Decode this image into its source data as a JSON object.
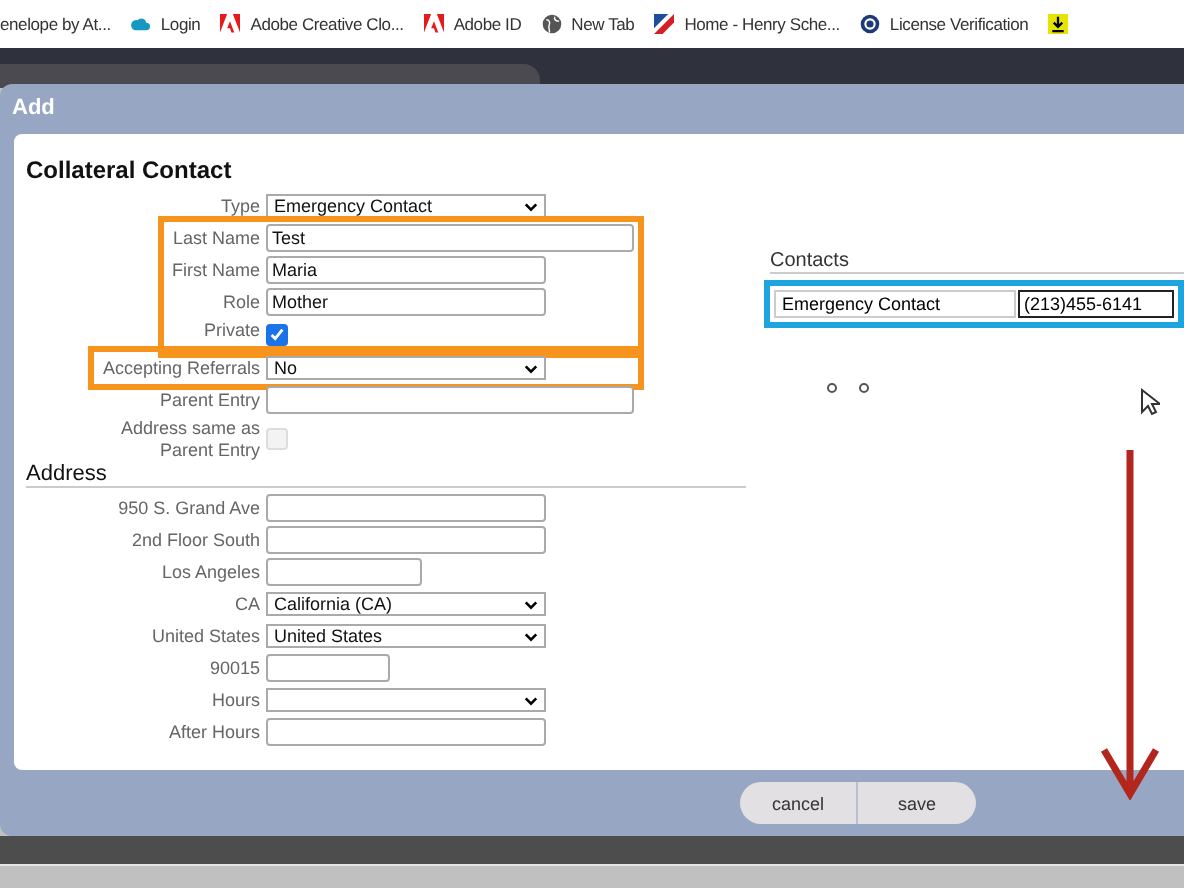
{
  "bookmarks": [
    {
      "label": "enelope by At...",
      "kind": "none"
    },
    {
      "label": "Login",
      "kind": "cloud"
    },
    {
      "label": "Adobe Creative Clo...",
      "kind": "adobe"
    },
    {
      "label": "Adobe ID",
      "kind": "adobe"
    },
    {
      "label": "New Tab",
      "kind": "globe"
    },
    {
      "label": "Home - Henry Sche...",
      "kind": "flag"
    },
    {
      "label": "License Verification",
      "kind": "seal"
    },
    {
      "kind": "download"
    }
  ],
  "dialog": {
    "title": "Add",
    "heading": "Collateral Contact",
    "sections": [
      {
        "highlighted": false,
        "rows": [
          {
            "kind": "select",
            "label": "Type",
            "value": "Emergency Contact"
          }
        ]
      },
      {
        "highlighted": true,
        "rows": [
          {
            "kind": "text",
            "label": "Last Name",
            "value": "Test",
            "wide": true
          },
          {
            "kind": "text",
            "label": "First Name",
            "value": "Maria"
          },
          {
            "kind": "text",
            "label": "Role",
            "value": "Mother"
          },
          {
            "kind": "checkbox",
            "label": "Private",
            "checked": true,
            "disabled": false
          }
        ]
      },
      {
        "highlighted": true,
        "rows": [
          {
            "kind": "select",
            "label": "Accepting Referrals",
            "value": "No"
          }
        ]
      },
      {
        "highlighted": false,
        "rows": [
          {
            "kind": "text",
            "label": "Parent Entry",
            "value": "",
            "wide": true
          },
          {
            "kind": "checkbox",
            "label": "Address same as Parent Entry",
            "checked": false,
            "disabled": true
          }
        ]
      }
    ],
    "address_heading": "Address",
    "address_rows": [
      {
        "kind": "text",
        "label": "950 S. Grand Ave",
        "value": ""
      },
      {
        "kind": "text",
        "label": "2nd Floor South",
        "value": ""
      },
      {
        "kind": "short",
        "label": "Los Angeles",
        "value": ""
      },
      {
        "kind": "select",
        "label": "CA",
        "value": "California (CA)"
      },
      {
        "kind": "select",
        "label": "United States",
        "value": "United States"
      },
      {
        "kind": "shorter",
        "label": "90015",
        "value": ""
      },
      {
        "kind": "select",
        "label": "Hours",
        "value": ""
      },
      {
        "kind": "text",
        "label": "After Hours",
        "value": ""
      }
    ],
    "contacts_heading": "Contacts",
    "contacts": [
      {
        "type": "Emergency Contact",
        "phone": "(213)455-6141",
        "highlighted": true
      }
    ],
    "buttons": [
      "cancel",
      "save"
    ]
  }
}
